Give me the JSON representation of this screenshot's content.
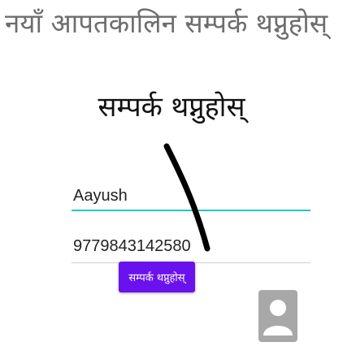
{
  "header": {
    "title": "नयाँ आपतकालिन सम्पर्क थप्नुहोस्"
  },
  "section": {
    "title": "सम्पर्क थप्नुहोस्"
  },
  "form": {
    "name_value": "Aayush",
    "phone_value": "9779843142580",
    "add_button_label": "सम्पर्क थप्नुहोस्"
  },
  "icons": {
    "contact": "contact-icon"
  },
  "colors": {
    "accent": "#6a12ee",
    "focus_underline": "#20c9c4",
    "contact_icon": "#a8a8a8"
  }
}
